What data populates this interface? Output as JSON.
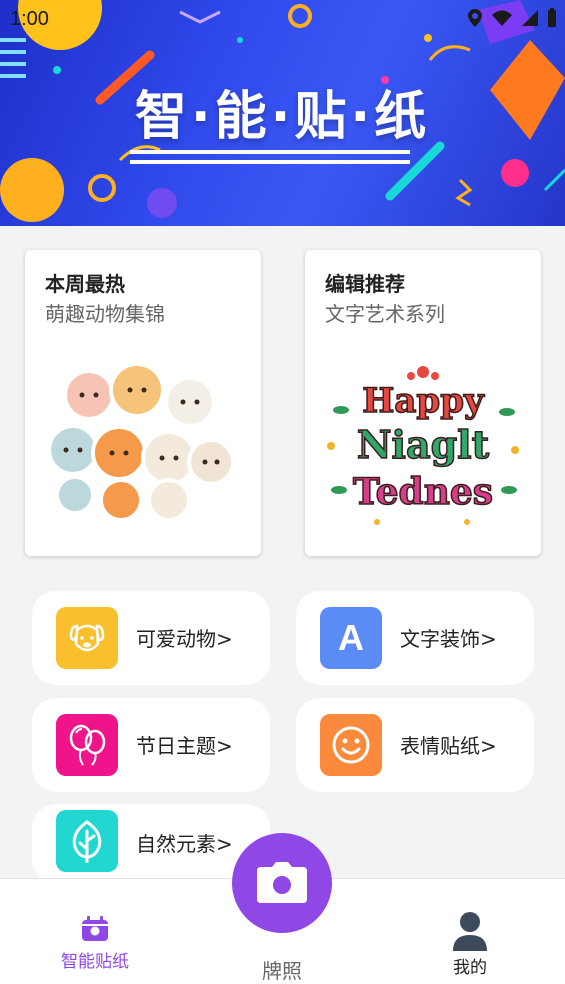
{
  "status_bar": {
    "time": "1:00"
  },
  "banner": {
    "title": "智·能·贴·纸"
  },
  "featured": [
    {
      "title": "本周最热",
      "subtitle": "萌趣动物集锦"
    },
    {
      "title": "编辑推荐",
      "subtitle": "文字艺术系列",
      "art_lines": [
        "Happy",
        "Niaglt",
        "Tednes"
      ]
    }
  ],
  "categories": [
    {
      "label": "可爱动物",
      "icon": "dog-icon",
      "color": "#f9bf2c"
    },
    {
      "label": "文字装饰",
      "icon": "letter-a-icon",
      "icon_text": "A",
      "color": "#5b8cf5"
    },
    {
      "label": "节日主题",
      "icon": "balloon-icon",
      "color": "#f0148a"
    },
    {
      "label": "表情贴纸",
      "icon": "smiley-icon",
      "color": "#fb8a3c"
    },
    {
      "label": "自然元素",
      "icon": "leaf-icon",
      "color": "#22d7d2"
    }
  ],
  "category_arrow": ">",
  "nav": {
    "home_label": "智能贴纸",
    "camera_label": "牌照",
    "profile_label": "我的",
    "active_color": "#8f47e6"
  }
}
